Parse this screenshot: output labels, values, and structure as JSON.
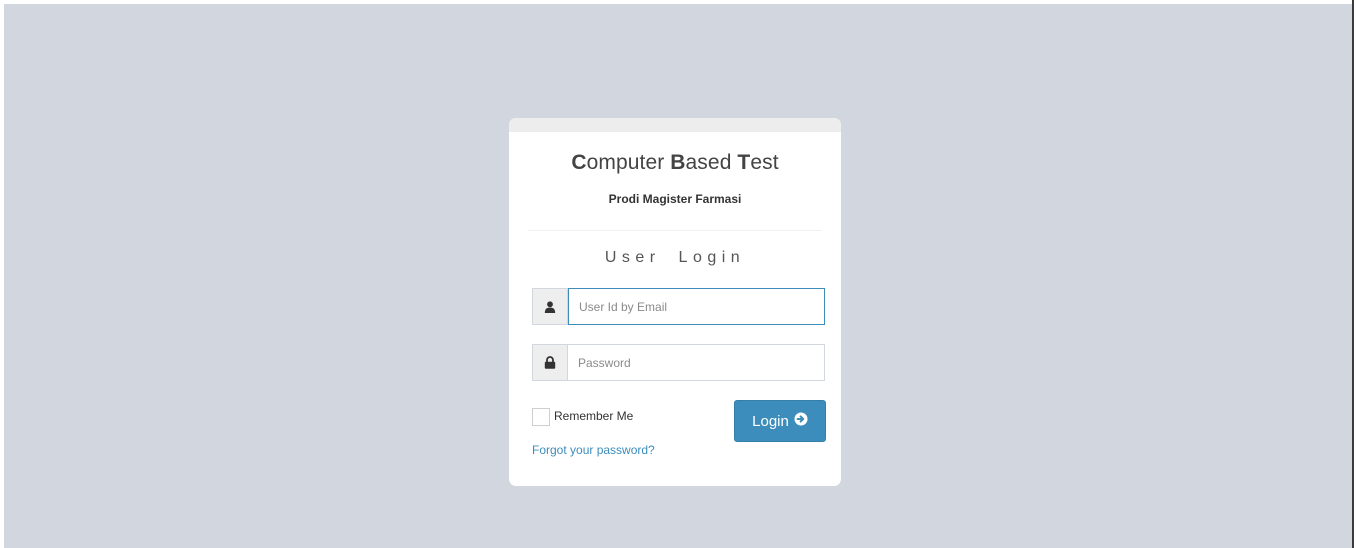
{
  "header": {
    "title_parts": [
      {
        "text": "C",
        "bold": true
      },
      {
        "text": "omputer ",
        "bold": false
      },
      {
        "text": "B",
        "bold": true
      },
      {
        "text": "ased ",
        "bold": false
      },
      {
        "text": "T",
        "bold": true
      },
      {
        "text": "est",
        "bold": false
      }
    ],
    "subtitle": "Prodi Magister Farmasi"
  },
  "form": {
    "heading": "User Login",
    "user_field": {
      "placeholder": "User Id by Email",
      "value": "",
      "icon": "user-icon"
    },
    "password_field": {
      "placeholder": "Password",
      "value": "",
      "icon": "lock-icon"
    },
    "remember_label": "Remember Me",
    "remember_checked": false,
    "login_label": "Login",
    "login_icon": "arrow-circle-right-icon",
    "forgot_link": "Forgot your password?"
  },
  "colors": {
    "page_background": "#d2d6de",
    "primary": "#3c8dbc",
    "box_background": "#ffffff"
  }
}
